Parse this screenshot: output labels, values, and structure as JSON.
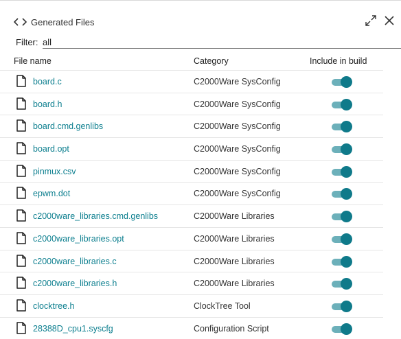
{
  "header": {
    "title": "Generated Files",
    "icons": [
      "code-icon",
      "expand-icon",
      "close-icon"
    ]
  },
  "filter": {
    "label": "Filter:",
    "value": "all"
  },
  "columns": {
    "file_name": "File name",
    "category": "Category",
    "include": "Include in build"
  },
  "colors": {
    "link": "#0d7f8f",
    "toggle_thumb": "#0f7a8a",
    "toggle_track": "#6cb0ba"
  },
  "rows": [
    {
      "file": "board.c",
      "category": "C2000Ware SysConfig",
      "include": true
    },
    {
      "file": "board.h",
      "category": "C2000Ware SysConfig",
      "include": true
    },
    {
      "file": "board.cmd.genlibs",
      "category": "C2000Ware SysConfig",
      "include": true
    },
    {
      "file": "board.opt",
      "category": "C2000Ware SysConfig",
      "include": true
    },
    {
      "file": "pinmux.csv",
      "category": "C2000Ware SysConfig",
      "include": true
    },
    {
      "file": "epwm.dot",
      "category": "C2000Ware SysConfig",
      "include": true
    },
    {
      "file": "c2000ware_libraries.cmd.genlibs",
      "category": "C2000Ware Libraries",
      "include": true
    },
    {
      "file": "c2000ware_libraries.opt",
      "category": "C2000Ware Libraries",
      "include": true
    },
    {
      "file": "c2000ware_libraries.c",
      "category": "C2000Ware Libraries",
      "include": true
    },
    {
      "file": "c2000ware_libraries.h",
      "category": "C2000Ware Libraries",
      "include": true
    },
    {
      "file": "clocktree.h",
      "category": "ClockTree Tool",
      "include": true
    },
    {
      "file": "28388D_cpu1.syscfg",
      "category": "Configuration Script",
      "include": true
    }
  ]
}
